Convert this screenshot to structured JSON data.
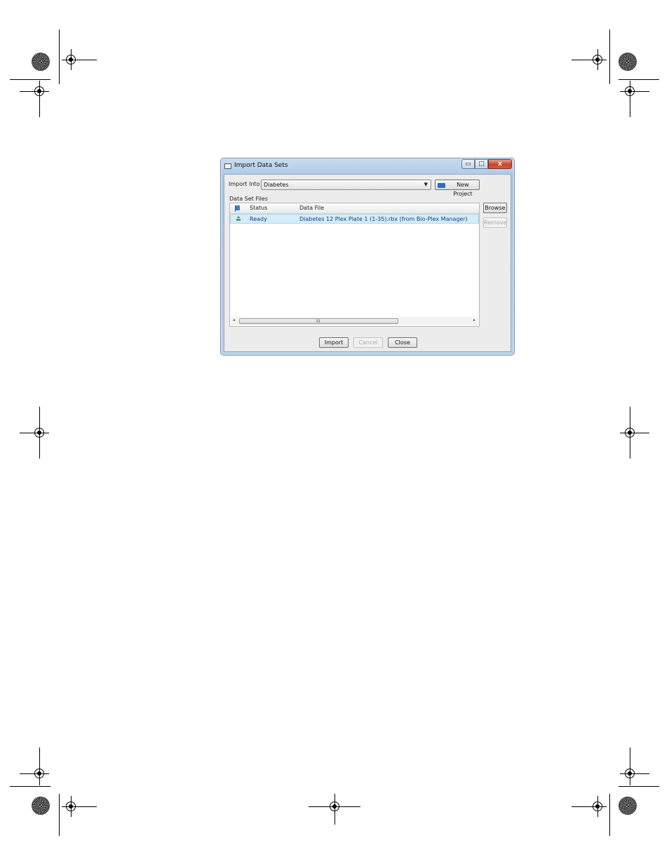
{
  "window": {
    "title": "Import Data Sets",
    "minimize_glyph": "▭",
    "maximize_glyph": "□",
    "close_glyph": "x"
  },
  "import_into": {
    "label": "Import Into",
    "selected": "Diabetes",
    "arrow_glyph": "▼"
  },
  "new_project_label": "New Project",
  "data_set_files": {
    "label": "Data Set Files",
    "columns": [
      "Status",
      "Data File"
    ],
    "rows": [
      {
        "status": "Ready",
        "data_file": "Diabetes 12 Plex Plate 1 (1-35).rbx (from Bio-Plex Manager)"
      }
    ],
    "scroll": {
      "left_arrow": "◂",
      "right_arrow": "▸",
      "grip": "III"
    }
  },
  "side_buttons": {
    "browse": "Browse",
    "remove": "Remove"
  },
  "footer_buttons": {
    "import": "Import",
    "cancel": "Cancel",
    "close": "Close"
  },
  "icons": [
    "flag-icon",
    "status-ready-icon",
    "folder-icon",
    "window-icon"
  ]
}
